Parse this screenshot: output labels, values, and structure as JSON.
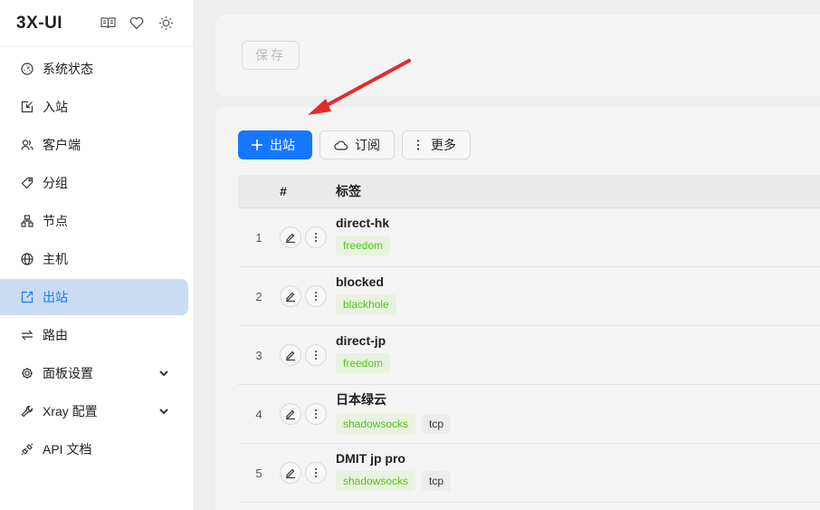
{
  "app": {
    "title": "3X-UI"
  },
  "header_icons": [
    "book-icon",
    "heart-icon",
    "sun-icon"
  ],
  "sidebar": {
    "items": [
      {
        "label": "系统状态",
        "icon": "dashboard-icon"
      },
      {
        "label": "入站",
        "icon": "inbound-icon"
      },
      {
        "label": "客户端",
        "icon": "users-icon"
      },
      {
        "label": "分组",
        "icon": "tag-icon"
      },
      {
        "label": "节点",
        "icon": "cluster-icon"
      },
      {
        "label": "主机",
        "icon": "globe-icon"
      },
      {
        "label": "出站",
        "icon": "outbound-icon",
        "active": true
      },
      {
        "label": "路由",
        "icon": "swap-icon"
      },
      {
        "label": "面板设置",
        "icon": "gear-icon",
        "expandable": true
      },
      {
        "label": "Xray 配置",
        "icon": "tool-icon",
        "expandable": true
      },
      {
        "label": "API 文档",
        "icon": "api-icon"
      }
    ]
  },
  "top_card": {
    "save_label": "保存"
  },
  "toolbar": {
    "add_outbound_label": "出站",
    "subscribe_label": "订阅",
    "more_label": "更多"
  },
  "table": {
    "headers": {
      "index": "#",
      "tag": "标签"
    },
    "rows": [
      {
        "index": "1",
        "name": "direct-hk",
        "tags": [
          {
            "text": "freedom",
            "kind": "green"
          }
        ]
      },
      {
        "index": "2",
        "name": "blocked",
        "tags": [
          {
            "text": "blackhole",
            "kind": "green"
          }
        ]
      },
      {
        "index": "3",
        "name": "direct-jp",
        "tags": [
          {
            "text": "freedom",
            "kind": "green"
          }
        ]
      },
      {
        "index": "4",
        "name": "日本绿云",
        "tags": [
          {
            "text": "shadowsocks",
            "kind": "green"
          },
          {
            "text": "tcp",
            "kind": "gray"
          }
        ]
      },
      {
        "index": "5",
        "name": "DMIT jp pro",
        "tags": [
          {
            "text": "shadowsocks",
            "kind": "green"
          },
          {
            "text": "tcp",
            "kind": "gray"
          }
        ]
      }
    ]
  },
  "colors": {
    "primary": "#1677ff",
    "active_bg": "#c9dcf2",
    "arrow": "#e52a2a",
    "tag_green": "#52c41a"
  }
}
